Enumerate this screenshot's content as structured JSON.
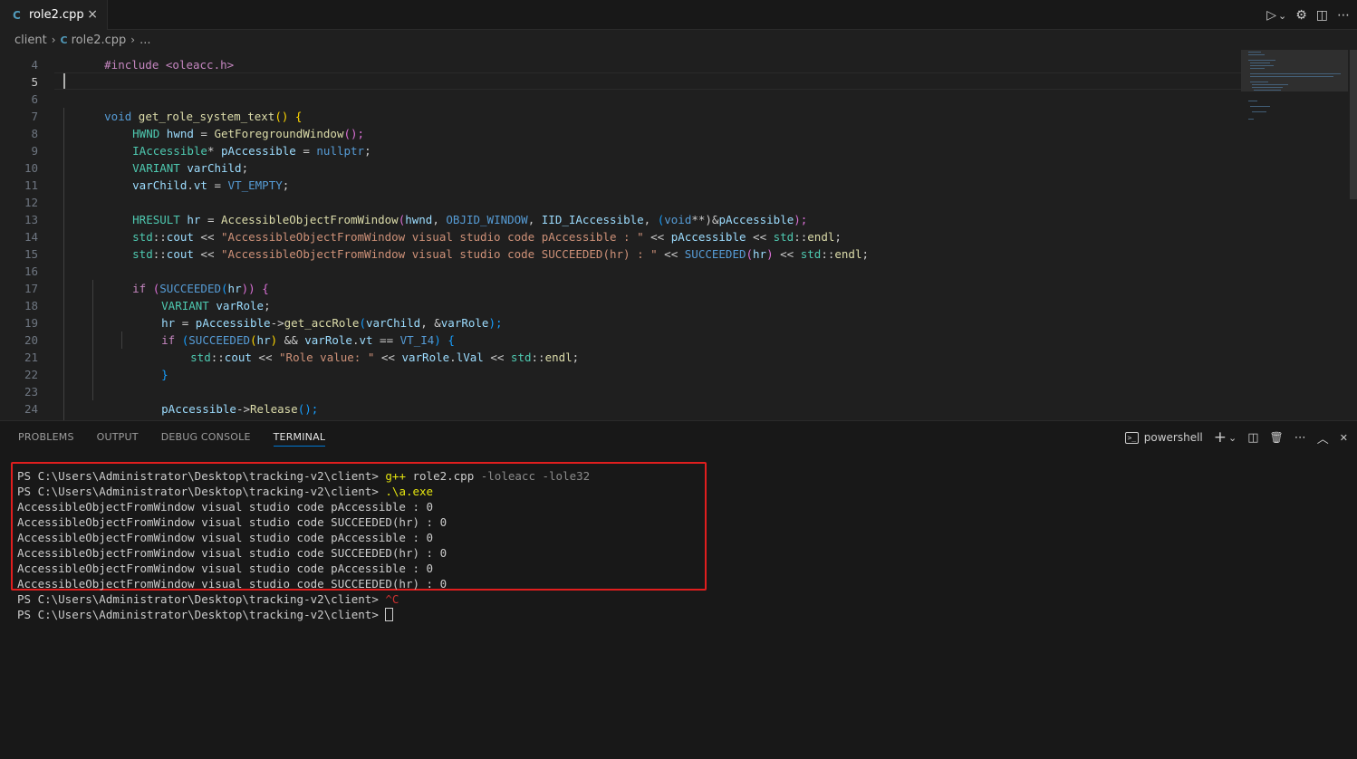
{
  "tab": {
    "label": "role2.cpp",
    "close": "×"
  },
  "editor_actions": {
    "run": "▷",
    "chevron": "⌄",
    "settings": "⚙",
    "split": "◫",
    "more": "⋯"
  },
  "breadcrumb": {
    "folder": "client",
    "file": "role2.cpp",
    "ellipsis": "..."
  },
  "line_numbers": [
    "4",
    "5",
    "6",
    "7",
    "8",
    "9",
    "10",
    "11",
    "12",
    "13",
    "14",
    "15",
    "16",
    "17",
    "18",
    "19",
    "20",
    "21",
    "22",
    "23",
    "24"
  ],
  "code": {
    "l3_partial": "#include <oleacc.h>",
    "l6": [
      "void",
      " ",
      "get_role_system_text",
      "() {"
    ],
    "l7": [
      "HWND",
      " ",
      "hwnd",
      " = ",
      "GetForegroundWindow",
      "();"
    ],
    "l8": [
      "IAccessible",
      "* ",
      "pAccessible",
      " = ",
      "nullptr",
      ";"
    ],
    "l9": [
      "VARIANT",
      " ",
      "varChild",
      ";"
    ],
    "l10": [
      "varChild",
      ".",
      "vt",
      " = ",
      "VT_EMPTY",
      ";"
    ],
    "l12": [
      "HRESULT",
      " ",
      "hr",
      " = ",
      "AccessibleObjectFromWindow",
      "(",
      "hwnd",
      ", ",
      "OBJID_WINDOW",
      ", ",
      "IID_IAccessible",
      ", ",
      "(",
      "void",
      "**)",
      "&",
      "pAccessible",
      ");"
    ],
    "l13": [
      "std",
      "::",
      "cout",
      " << ",
      "\"AccessibleObjectFromWindow visual studio code pAccessible : \"",
      " << ",
      "pAccessible",
      " << ",
      "std",
      "::",
      "endl",
      ";"
    ],
    "l14": [
      "std",
      "::",
      "cout",
      " << ",
      "\"AccessibleObjectFromWindow visual studio code SUCCEEDED(hr) : \"",
      " << ",
      "SUCCEEDED",
      "(",
      "hr",
      ")",
      " << ",
      "std",
      "::",
      "endl",
      ";"
    ],
    "l16": [
      "if",
      " ",
      "(",
      "SUCCEEDED",
      "(",
      "hr",
      "))",
      " {"
    ],
    "l17": [
      "VARIANT",
      " ",
      "varRole",
      ";"
    ],
    "l18": [
      "hr",
      " = ",
      "pAccessible",
      "->",
      "get_accRole",
      "(",
      "varChild",
      ", &",
      "varRole",
      ");"
    ],
    "l19": [
      "if",
      " ",
      "(",
      "SUCCEEDED",
      "(",
      "hr",
      ")",
      " && ",
      "varRole",
      ".",
      "vt",
      " == ",
      "VT_I4",
      ")",
      " {"
    ],
    "l20": [
      "std",
      "::",
      "cout",
      " << ",
      "\"Role value: \"",
      " << ",
      "varRole",
      ".",
      "lVal",
      " << ",
      "std",
      "::",
      "endl",
      ";"
    ],
    "l21": [
      "}"
    ],
    "l23": [
      "pAccessible",
      "->",
      "Release",
      "();"
    ],
    "l24": [
      "}"
    ]
  },
  "panel": {
    "tabs": [
      "PROBLEMS",
      "OUTPUT",
      "DEBUG CONSOLE",
      "TERMINAL"
    ],
    "active_tab": "TERMINAL",
    "shell": "powershell",
    "actions": {
      "add": "+",
      "chevron": "⌄",
      "split": "◫",
      "trash": "🗑",
      "more": "⋯",
      "maximize": "︿",
      "close": "✕"
    }
  },
  "terminal": {
    "prompt": "PS C:\\Users\\Administrator\\Desktop\\tracking-v2\\client> ",
    "cmd1": {
      "exe": "g++",
      "file": " role2.cpp",
      "args": " -loleacc -lole32"
    },
    "cmd2": ".\\a.exe",
    "output": [
      "AccessibleObjectFromWindow visual studio code pAccessible : 0",
      "AccessibleObjectFromWindow visual studio code SUCCEEDED(hr) : 0",
      "AccessibleObjectFromWindow visual studio code pAccessible : 0",
      "AccessibleObjectFromWindow visual studio code SUCCEEDED(hr) : 0",
      "AccessibleObjectFromWindow visual studio code pAccessible : 0",
      "AccessibleObjectFromWindow visual studio code SUCCEEDED(hr) : 0"
    ],
    "ctrl_c": "^C"
  },
  "colors": {
    "highlight_box": "#e01e1e",
    "accent": "#0078d4"
  }
}
